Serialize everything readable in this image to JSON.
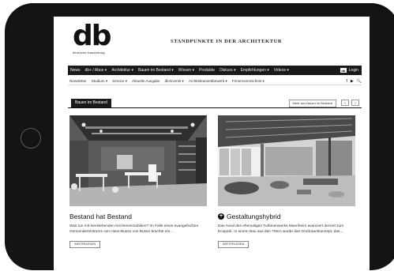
{
  "brand": {
    "logo_mark": "db",
    "logo_sub": "deutsche bauzeitung",
    "tagline": "STANDPUNKTE IN DER ARCHITEKTUR"
  },
  "main_nav": {
    "items": [
      "News",
      "db+ / Abos ▾",
      "Architektur ▾",
      "Bauen im Bestand ▾",
      "Wissen ▾",
      "Produkte",
      "Diskurs ▾",
      "Empfehlungen ▾",
      "Videos ▾"
    ],
    "login_badge": "db",
    "login_label": "Login"
  },
  "sub_nav": {
    "items": [
      "Newsletter",
      "Studium ▾",
      "Service ▾",
      "Aktuelle Ausgabe",
      "db-Events ▾",
      "Architekturwettbewerb ▾",
      "Firmenverzeichnis ▾"
    ],
    "social": [
      "f",
      "▶",
      "🔍"
    ]
  },
  "section": {
    "tab_label": "Bauen im Bestand",
    "more_label": "Mehr aus Bauen im Bestand",
    "prev": "‹",
    "next": "›"
  },
  "articles": [
    {
      "title": "Bestand hat Bestand",
      "text": "Was tun mit leerstehenden Kirchenimmobilien? Im Falle eines evangelischen Gemeindezentrums von Hans-Busso von Busse brachte ein...",
      "read_more": "WEITERLESEN"
    },
    {
      "title": "Gestaltungshybrid",
      "text": "Das Areal des ehemaligen Turbinenwerks Mannheim avanciert derzeit zum Ecopark. In einem Bau aus den 70ern wurde das Großraumkonzept, das...",
      "read_more": "WEITERLESEN"
    }
  ]
}
